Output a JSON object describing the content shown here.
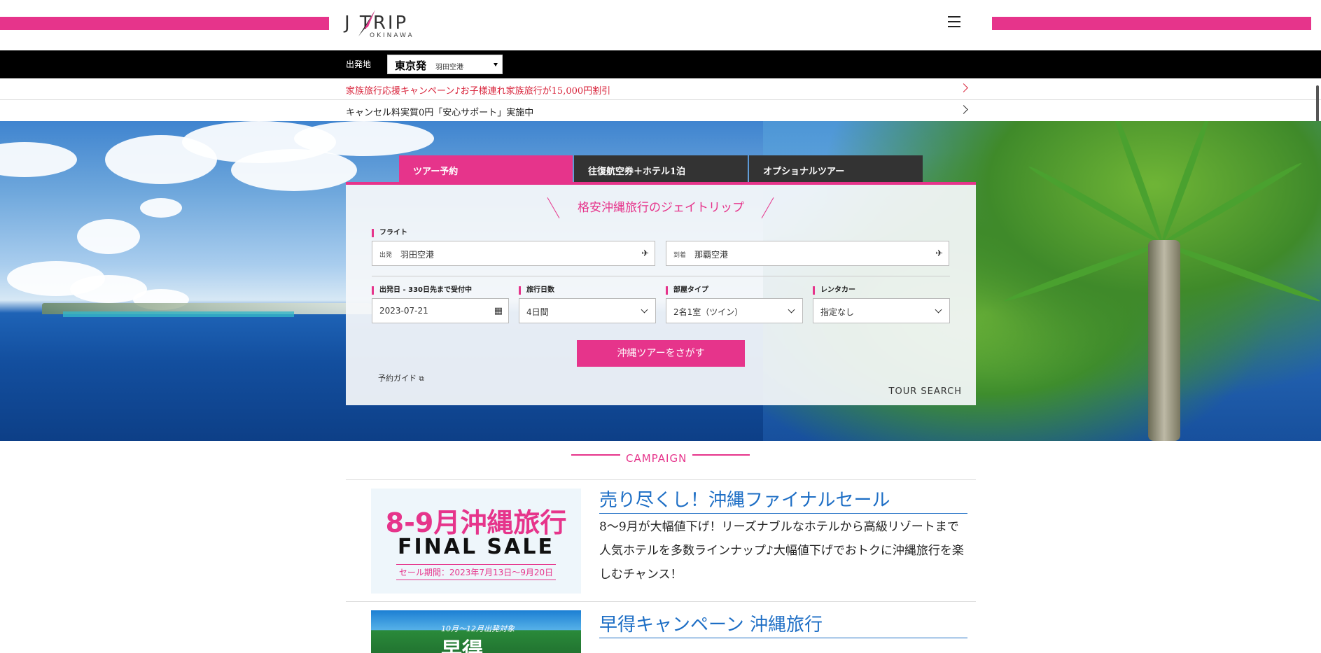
{
  "header": {
    "logo_text": "J TRIP",
    "logo_sub": "OKINAWA"
  },
  "departure": {
    "label": "出発地",
    "city": "東京発",
    "airport": "羽田空港"
  },
  "notices": [
    {
      "text": "家族旅行応援キャンペーン♪お子様連れ家族旅行が15,000円割引"
    },
    {
      "text": "キャンセル料実質0円「安心サポート」実施中"
    }
  ],
  "search": {
    "tabs": [
      "ツアー予約",
      "往復航空券＋ホテル1泊",
      "オプショナルツアー"
    ],
    "title": "格安沖縄旅行のジェイトリップ",
    "flight_label": "フライト",
    "from_prefix": "出発",
    "from_value": "羽田空港",
    "to_prefix": "到着",
    "to_value": "那覇空港",
    "date_label": "出発日 - 330日先まで受付中",
    "date_value": "2023-07-21",
    "days_label": "旅行日数",
    "days_value": "4日間",
    "room_label": "部屋タイプ",
    "room_value": "2名1室（ツイン）",
    "car_label": "レンタカー",
    "car_value": "指定なし",
    "button": "沖縄ツアーをさがす",
    "guide": "予約ガイド",
    "tour_search": "TOUR SEARCH"
  },
  "campaign": {
    "heading": "CAMPAIGN",
    "items": [
      {
        "img_line1": "8-9月沖縄旅行",
        "img_line2": "FINAL SALE",
        "img_line3": "セール期間：2023年7月13日～9月20日",
        "title": "売り尽くし！沖縄ファイナルセール",
        "desc": "8〜9月が大幅値下げ！リーズナブルなホテルから高級リゾートまで人気ホテルを多数ラインナップ♪大幅値下げでおトクに沖縄旅行を楽しむチャンス！"
      },
      {
        "img_line1": "10月〜12月出発対象",
        "img_line2": "早得",
        "title": "早得キャンペーン 沖縄旅行"
      }
    ]
  },
  "colors": {
    "accent": "#e6348b",
    "link_blue": "#1d6ec5",
    "dark_tab": "#333333"
  }
}
